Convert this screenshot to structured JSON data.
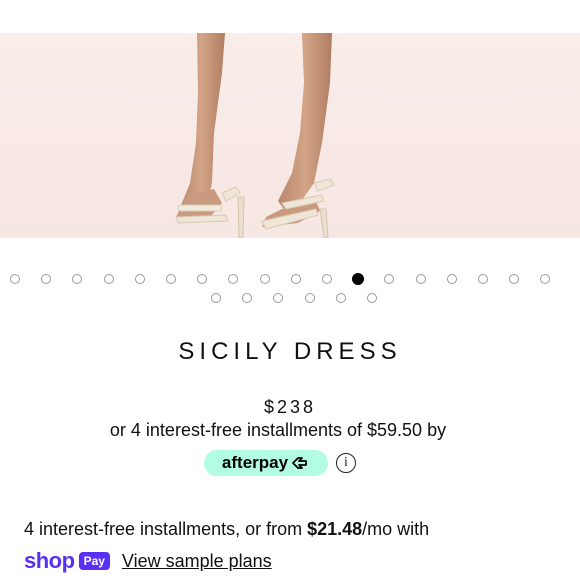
{
  "product": {
    "image_alt": "White strappy heeled sandals",
    "title": "SICILY DRESS",
    "price": "$238"
  },
  "carousel": {
    "total_dots": 24,
    "active_index": 11,
    "row1_count": 18,
    "row2_count": 6
  },
  "afterpay": {
    "installment_text": "or 4 interest-free installments of $59.50 by",
    "badge_label": "afterpay",
    "badge_color": "#b2fce4",
    "info_icon": "info-icon"
  },
  "shop_pay": {
    "text_prefix": "4 interest-free installments, or from ",
    "amount": "$21.48",
    "text_suffix": "/mo with",
    "logo_shop": "shop",
    "logo_pay": "Pay",
    "link_label": "View sample plans",
    "brand_color": "#5a31f4"
  }
}
